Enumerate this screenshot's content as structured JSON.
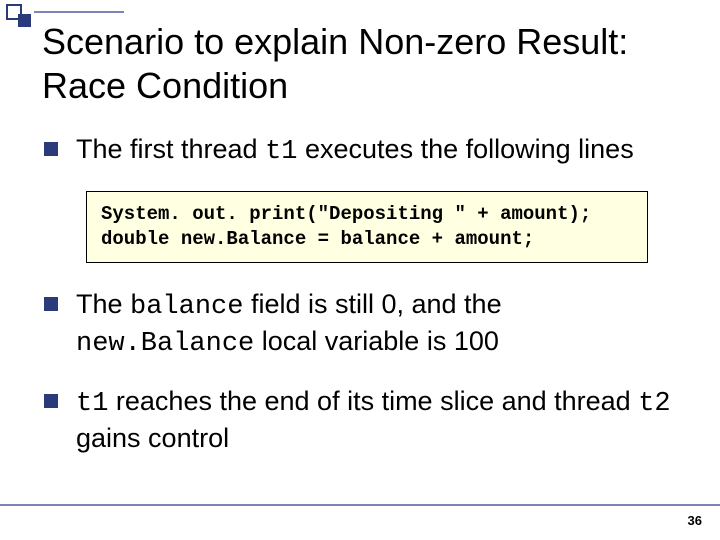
{
  "title": "Scenario to explain Non-zero Result: Race Condition",
  "bullets": {
    "b1": {
      "pre": "The first thread ",
      "code": "t1",
      "post": " executes the following lines"
    },
    "b2": {
      "pre": "The ",
      "code1": "balance",
      "mid1": " field is still 0, and the ",
      "code2": "new.Balance",
      "mid2": " local variable is 100"
    },
    "b3": {
      "code1": "t1",
      "mid1": " reaches the end of its time slice and thread ",
      "code2": "t2",
      "post": " gains control"
    }
  },
  "code": {
    "line1": "System. out. print(\"Depositing \" + amount);",
    "line2": "double new.Balance = balance + amount;"
  },
  "page_number": "36"
}
